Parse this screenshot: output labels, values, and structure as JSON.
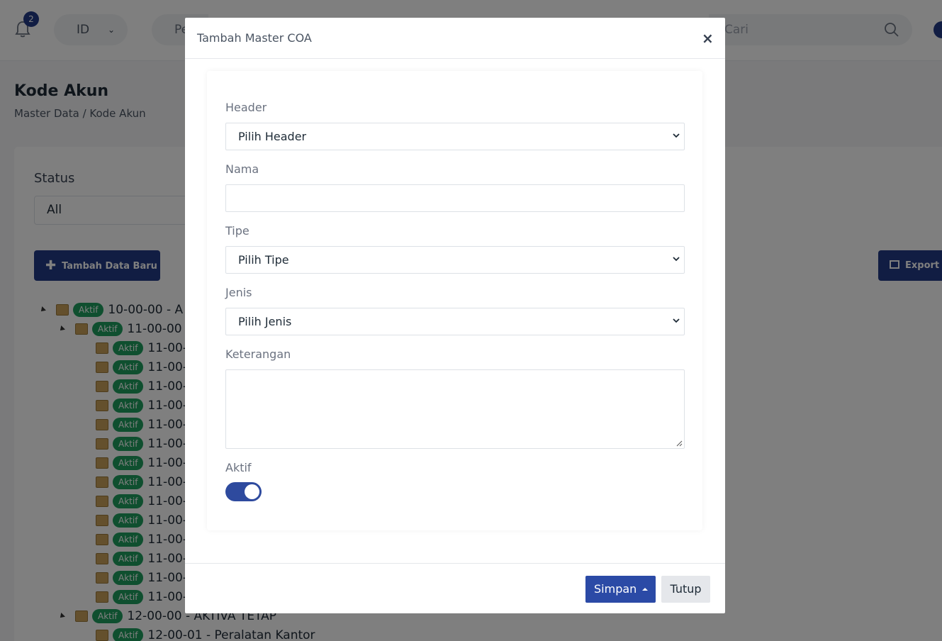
{
  "topbar": {
    "notification_count": "2",
    "language": "ID",
    "project_partial": "Pe",
    "search_placeholder": "Cari"
  },
  "page": {
    "title": "Kode Akun",
    "breadcrumb": "Master Data / Kode Akun"
  },
  "filter": {
    "status_label": "Status",
    "status_value": "All"
  },
  "actions": {
    "add_label": "Tambah Data Baru",
    "export_label": "Export E"
  },
  "tree": {
    "badge": "Aktif",
    "rows": [
      {
        "text": "10-00-00 - A"
      },
      {
        "text": "11-00-00"
      },
      {
        "text": "11-00-"
      },
      {
        "text": "11-00-"
      },
      {
        "text": "11-00-"
      },
      {
        "text": "11-00-"
      },
      {
        "text": "11-00-"
      },
      {
        "text": "11-00-"
      },
      {
        "text": "11-00-"
      },
      {
        "text": "11-00-"
      },
      {
        "text": "11-00-"
      },
      {
        "text": "11-00-"
      },
      {
        "text": "11-00-"
      },
      {
        "text": "11-00-"
      },
      {
        "text": "11-00-"
      },
      {
        "text": "11-00-"
      },
      {
        "text": "12-00-00 - AKTIVA TETAP"
      },
      {
        "text": "12-00-01 - Peralatan Kantor"
      }
    ]
  },
  "modal": {
    "title": "Tambah Master COA",
    "close_symbol": "×",
    "fields": {
      "header_label": "Header",
      "header_value": "Pilih Header",
      "nama_label": "Nama",
      "nama_value": "",
      "tipe_label": "Tipe",
      "tipe_value": "Pilih Tipe",
      "jenis_label": "Jenis",
      "jenis_value": "Pilih Jenis",
      "keterangan_label": "Keterangan",
      "aktif_label": "Aktif",
      "aktif_on": true
    },
    "footer": {
      "save_label": "Simpan",
      "close_label": "Tutup"
    }
  },
  "colors": {
    "primary": "#233a87",
    "badge_green": "#1e9e5e",
    "toggle_on": "#2e4a9e"
  }
}
